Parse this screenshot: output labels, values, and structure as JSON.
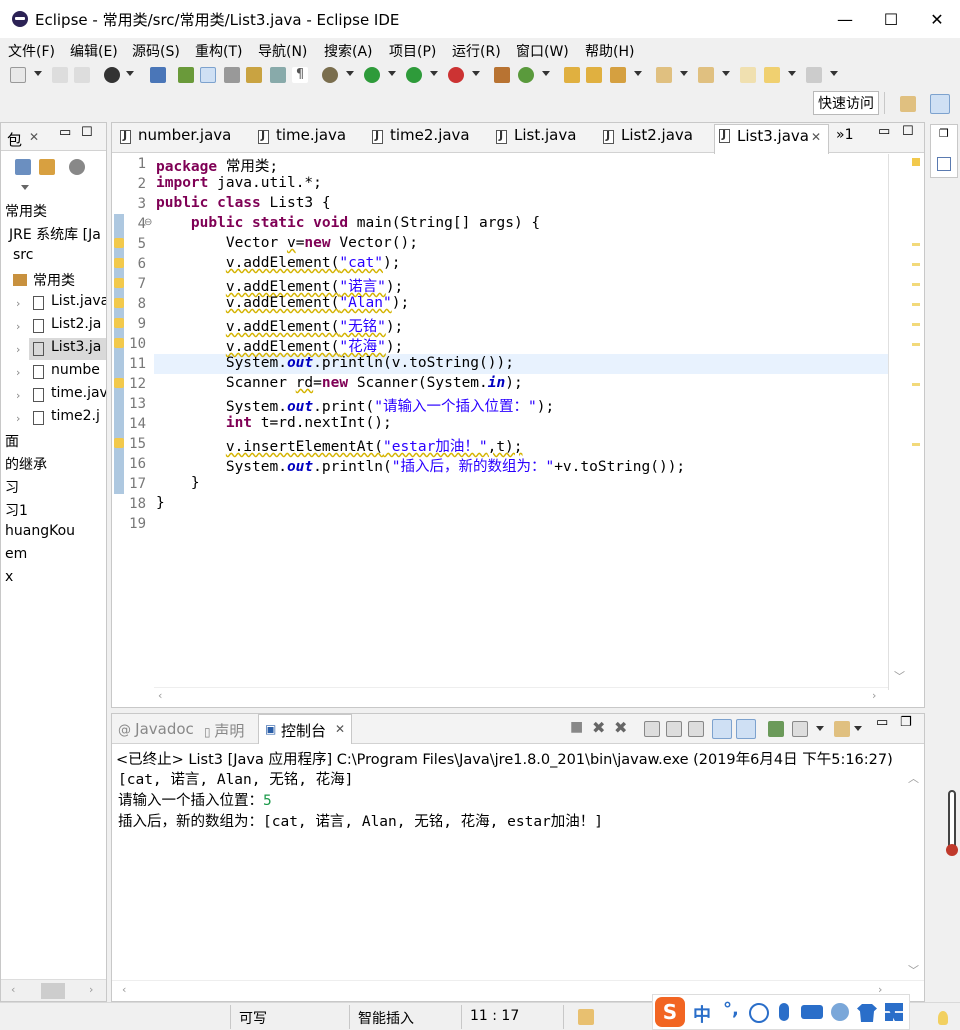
{
  "window": {
    "title": "Eclipse - 常用类/src/常用类/List3.java - Eclipse IDE",
    "minimize": "—",
    "maximize": "☐",
    "close": "✕"
  },
  "menu": [
    "文件(F)",
    "编辑(E)",
    "源码(S)",
    "重构(T)",
    "导航(N)",
    "搜索(A)",
    "项目(P)",
    "运行(R)",
    "窗口(W)",
    "帮助(H)"
  ],
  "quick_access": "快速访问",
  "left_panel": {
    "tab_label": "包",
    "tree": [
      "常用类",
      "JRE 系统库 [Ja",
      "src",
      "常用类",
      "List.java",
      "List2.ja",
      "List3.ja",
      "numbe",
      "time.jav",
      "time2.j",
      "面",
      "的继承",
      "习",
      "习1",
      "huangKou",
      "em",
      "x"
    ]
  },
  "editor": {
    "tabs": [
      "number.java",
      "time.java",
      "time2.java",
      "List.java",
      "List2.java",
      "List3.java"
    ],
    "active_tab": "List3.java",
    "overflow": "»1",
    "line_numbers": [
      "1",
      "2",
      "3",
      "4",
      "5",
      "6",
      "7",
      "8",
      "9",
      "10",
      "11",
      "12",
      "13",
      "14",
      "15",
      "16",
      "17",
      "18",
      "19"
    ],
    "code": {
      "l1_kw": "package",
      "l1_rest": " 常用类;",
      "l2_kw": "import",
      "l2_rest": " java.util.*;",
      "l3_kw1": "public",
      "l3_kw2": " class",
      "l3_rest": " List3 {",
      "l4_kw1": "    public",
      "l4_kw2": " static",
      "l4_kw3": " void",
      "l4_rest": " main(String[] args) {",
      "l5_a": "        Vector ",
      "l5_v": "v",
      "l5_b": "=",
      "l5_kw": "new",
      "l5_c": " Vector();",
      "l6_a": "        ",
      "l6_v": "v.addElement(",
      "l6_s": "\"cat\"",
      "l6_c": ");",
      "l7_a": "        ",
      "l7_v": "v.addElement(",
      "l7_s": "\"诺言\"",
      "l7_c": ");",
      "l8_a": "        ",
      "l8_v": "v.addElement(",
      "l8_s": "\"Alan\"",
      "l8_c": ");",
      "l9_a": "        ",
      "l9_v": "v.addElement(",
      "l9_s": "\"无铭\"",
      "l9_c": ");",
      "l10_a": "        ",
      "l10_v": "v.addElement(",
      "l10_s": "\"花海\"",
      "l10_c": ");",
      "l11_a": "        System.",
      "l11_f": "out",
      "l11_c": ".println(v.toString());",
      "l12_a": "        Scanner ",
      "l12_v": "rd",
      "l12_b": "=",
      "l12_kw": "new",
      "l12_c": " Scanner(System.",
      "l12_f": "in",
      "l12_d": ");",
      "l13_a": "        System.",
      "l13_f": "out",
      "l13_b": ".print(",
      "l13_s": "\"请输入一个插入位置：\"",
      "l13_c": ");",
      "l14_a": "        ",
      "l14_kw": "int",
      "l14_c": " t=rd.nextInt();",
      "l15_a": "        ",
      "l15_v": "v.insertElementAt(",
      "l15_s": "\"estar加油！\"",
      "l15_c": ",t);",
      "l16_a": "        System.",
      "l16_f": "out",
      "l16_b": ".println(",
      "l16_s": "\"插入后，新的数组为：\"",
      "l16_c": "+v.toString());",
      "l17": "    }",
      "l18": "}",
      "l19": ""
    }
  },
  "console": {
    "tabs": [
      "Javadoc",
      "声明",
      "控制台"
    ],
    "active_tab": "控制台",
    "header": "<已终止> List3 [Java 应用程序] C:\\Program Files\\Java\\jre1.8.0_201\\bin\\javaw.exe  (2019年6月4日 下午5:16:27)",
    "out1": "[cat, 诺言, Alan, 无铭, 花海]",
    "out2_prompt": "请输入一个插入位置：",
    "out2_input": "5",
    "out3": "插入后，新的数组为：[cat, 诺言, Alan, 无铭, 花海, estar加油！]"
  },
  "status": {
    "writable": "可写",
    "insert_mode": "智能插入",
    "position": "11 : 17"
  },
  "ime": {
    "logo": "S",
    "mode": "中",
    "punct": "°,"
  },
  "colors": {
    "keyword": "#7f0055",
    "string": "#2a00ff",
    "field": "#0000c0",
    "current_line": "#e8f2fe",
    "ime_orange": "#f26522"
  }
}
